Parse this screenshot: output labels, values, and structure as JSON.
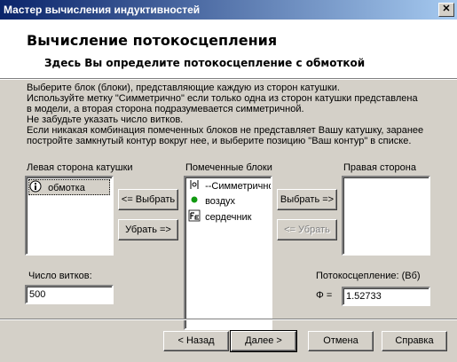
{
  "window": {
    "title": "Мастер вычисления индуктивностей",
    "close_label": "✕"
  },
  "header": {
    "title": "Вычисление потокосцепления",
    "subtitle": "Здесь Вы определите потокосцепление с обмоткой"
  },
  "instructions": [
    "Выберите блок (блоки),  представляющие каждую из сторон катушки.",
    "Используйте метку \"Симметрично\" если только одна из сторон катушки представлена",
    "в модели, а вторая сторона подразумевается симметричной.",
    "Не забудьте указать число витков.",
    "Если никакая комбинация помеченных блоков не представляет Вашу катушку, заранее",
    "постройте замкнутый контур вокруг нее, и выберите позицию  \"Ваш контур\" в списке."
  ],
  "left_panel": {
    "label": "Левая сторона катушки",
    "items": [
      {
        "label": "обмотка",
        "icon": "info-icon"
      }
    ]
  },
  "middle_panel": {
    "label": "Помеченные блоки",
    "items": [
      {
        "label": "--Симметрично",
        "icon": "symmetry-icon"
      },
      {
        "label": "воздух",
        "icon": "green-dot-icon"
      },
      {
        "label": "сердечник",
        "icon": "fe-icon"
      }
    ]
  },
  "right_panel": {
    "label": "Правая сторона",
    "items": []
  },
  "buttons": {
    "select_left": "<= Выбрать",
    "remove_left": "Убрать =>",
    "select_right": "Выбрать =>",
    "remove_right": "<= Убрать"
  },
  "turns": {
    "label": "Число витков:",
    "value": "500"
  },
  "flux": {
    "label": "Потокосцепление:  (Вб)",
    "symbol": "Φ =",
    "value": "1.52733"
  },
  "footer": {
    "back": "< Назад",
    "next": "Далее >",
    "cancel": "Отмена",
    "help": "Справка"
  },
  "colors": {
    "titlebar_start": "#0a246a",
    "titlebar_end": "#a6caf0",
    "face": "#d4d0c8"
  }
}
